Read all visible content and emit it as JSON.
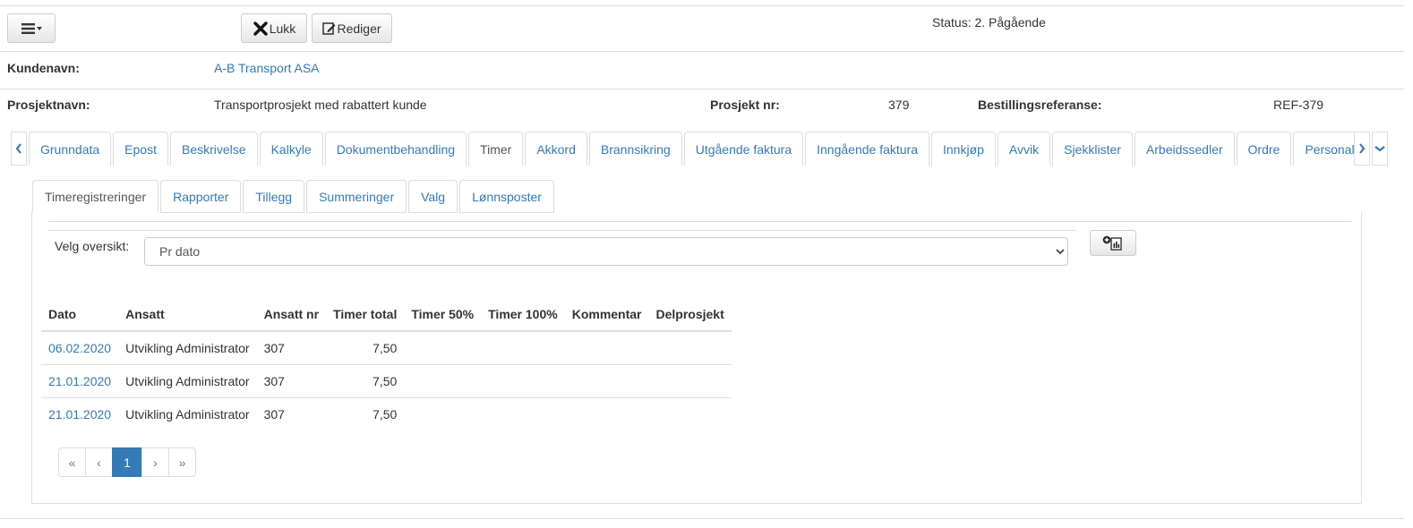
{
  "toolbar": {
    "menu_icon": "hamburger-icon",
    "close_label": "Lukk",
    "edit_label": "Rediger",
    "status_text": "Status: 2. Pågående"
  },
  "fields": {
    "customer_label": "Kundenavn:",
    "customer_value": "A-B Transport ASA",
    "project_name_label": "Prosjektnavn:",
    "project_name_value": "Transportprosjekt med rabattert kunde",
    "project_nr_label": "Prosjekt nr:",
    "project_nr_value": "379",
    "order_ref_label": "Bestillingsreferanse:",
    "order_ref_value": "REF-379"
  },
  "tabs": [
    {
      "label": "Grunndata"
    },
    {
      "label": "Epost"
    },
    {
      "label": "Beskrivelse"
    },
    {
      "label": "Kalkyle"
    },
    {
      "label": "Dokumentbehandling"
    },
    {
      "label": "Timer",
      "active": true
    },
    {
      "label": "Akkord"
    },
    {
      "label": "Brannsikring"
    },
    {
      "label": "Utgående faktura"
    },
    {
      "label": "Inngående faktura"
    },
    {
      "label": "Innkjøp"
    },
    {
      "label": "Avvik"
    },
    {
      "label": "Sjekklister"
    },
    {
      "label": "Arbeidssedler"
    },
    {
      "label": "Ordre"
    },
    {
      "label": "Personalliste"
    }
  ],
  "subtabs": [
    {
      "label": "Timeregistreringer",
      "active": true
    },
    {
      "label": "Rapporter"
    },
    {
      "label": "Tillegg"
    },
    {
      "label": "Summeringer"
    },
    {
      "label": "Valg"
    },
    {
      "label": "Lønnsposter"
    }
  ],
  "overview": {
    "label": "Velg oversikt:",
    "selected": "Pr dato"
  },
  "table": {
    "columns": [
      "Dato",
      "Ansatt",
      "Ansatt nr",
      "Timer total",
      "Timer 50%",
      "Timer 100%",
      "Kommentar",
      "Delprosjekt"
    ],
    "rows": [
      [
        "06.02.2020",
        "Utvikling Administrator",
        "307",
        "7,50",
        "",
        "",
        "",
        ""
      ],
      [
        "21.01.2020",
        "Utvikling Administrator",
        "307",
        "7,50",
        "",
        "",
        "",
        ""
      ],
      [
        "21.01.2020",
        "Utvikling Administrator",
        "307",
        "7,50",
        "",
        "",
        "",
        ""
      ]
    ]
  },
  "pager": {
    "first": "«",
    "prev": "‹",
    "current": "1",
    "next": "›",
    "last": "»"
  },
  "colors": {
    "link": "#337ab7",
    "border": "#dddddd",
    "active_page": "#337ab7"
  }
}
